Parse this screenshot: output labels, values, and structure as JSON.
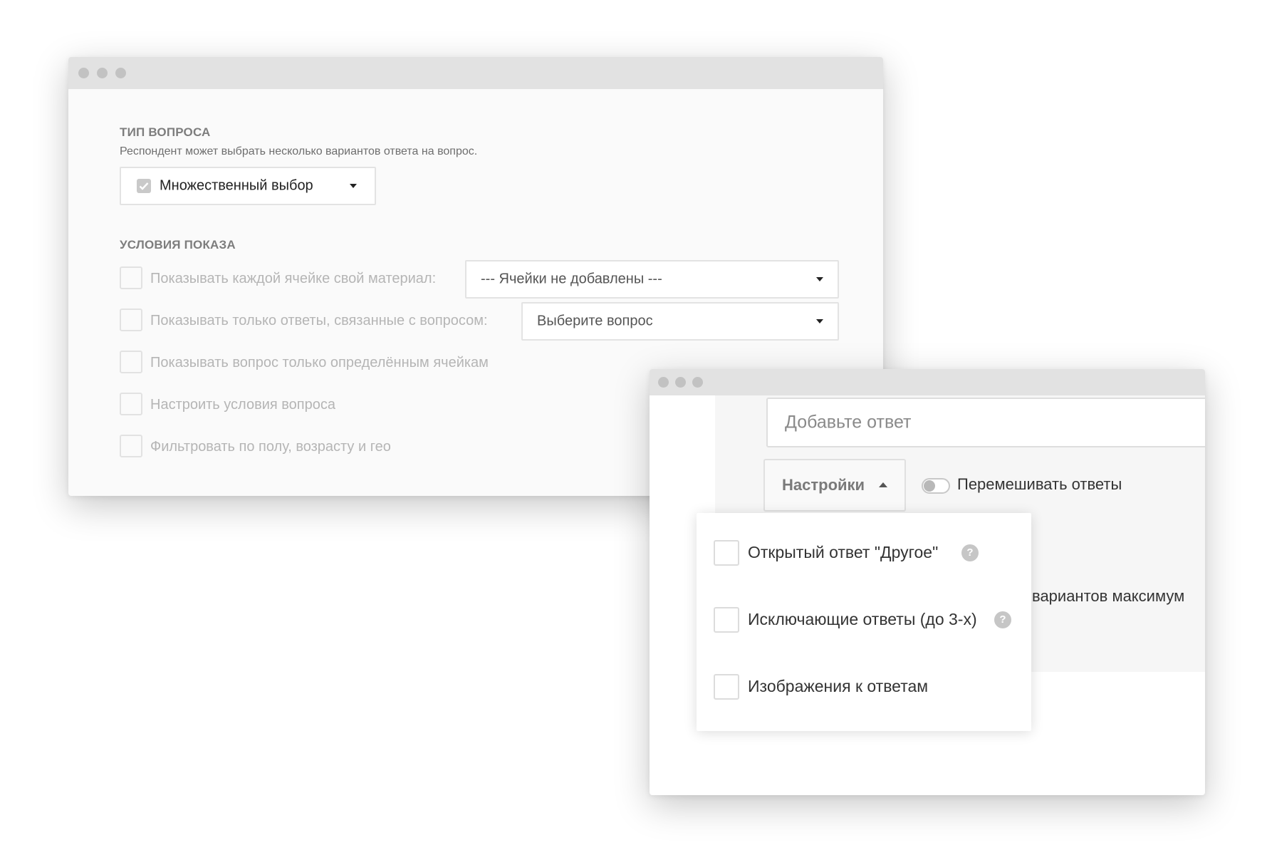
{
  "question_type": {
    "title": "ТИП ВОПРОСА",
    "description": "Респондент может выбрать несколько вариантов ответа на вопрос.",
    "selected": "Множественный выбор",
    "icon": "checkbox-icon"
  },
  "display_conditions": {
    "title": "УСЛОВИЯ ПОКАЗА",
    "rows": [
      {
        "label": "Показывать каждой ячейке свой материал:",
        "select": "--- Ячейки не добавлены ---",
        "checked": false
      },
      {
        "label": "Показывать только ответы, связанные с вопросом:",
        "select": "Выберите вопрос",
        "checked": false
      },
      {
        "label": "Показывать вопрос только определённым ячейкам",
        "checked": false
      },
      {
        "label": "Настроить условия вопроса",
        "checked": false
      },
      {
        "label": "Фильтровать по полу, возрасту и гео",
        "checked": false
      }
    ]
  },
  "answers": {
    "input_placeholder": "Добавьте ответ",
    "settings_button": "Настройки",
    "shuffle_label": "Перемешивать ответы",
    "shuffle_on": false,
    "partial_text": "вариантов максимум"
  },
  "settings_menu": {
    "items": [
      {
        "label": "Открытый ответ \"Другое\"",
        "help": "?",
        "checked": false
      },
      {
        "label": "Исключающие ответы (до 3-х)",
        "help": "?",
        "checked": false
      },
      {
        "label": "Изображения к ответам",
        "checked": false
      }
    ]
  },
  "colors": {
    "titlebar": "#e2e2e2",
    "window_dot": "#c2c2c2",
    "muted_text": "#b5b5b5",
    "text": "#333333"
  }
}
